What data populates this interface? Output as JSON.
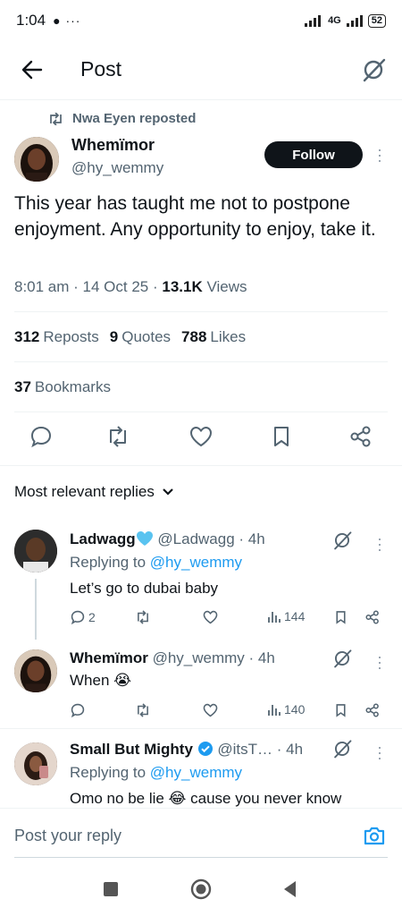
{
  "status_bar": {
    "time": "1:04",
    "extra": "● ···",
    "network": "4G",
    "battery": "52"
  },
  "header": {
    "title": "Post"
  },
  "repost": {
    "text": "Nwa Eyen reposted"
  },
  "tweet": {
    "author_name": "Whemïmor",
    "author_handle": "@hy_wemmy",
    "follow_label": "Follow",
    "text": "This year has taught me not to postpone enjoyment. Any opportunity to enjoy, take it.",
    "time": "8:01 am",
    "date": "14 Oct 25",
    "views_count": "13.1K",
    "views_label": "Views",
    "reposts_count": "312",
    "reposts_label": "Reposts",
    "quotes_count": "9",
    "quotes_label": "Quotes",
    "likes_count": "788",
    "likes_label": "Likes",
    "bookmarks_count": "37",
    "bookmarks_label": "Bookmarks"
  },
  "replies_header": {
    "label": "Most relevant replies"
  },
  "replies": [
    {
      "name": "Ladwagg",
      "handle": "@Ladwagg · 4h",
      "replying_to": "Replying to",
      "mention": "@hy_wemmy",
      "text": "Let’s go to dubai baby",
      "reply_count": "2",
      "views": "144"
    },
    {
      "name": "Whemïmor",
      "handle": "@hy_wemmy · 4h",
      "text": "When 😭",
      "views": "140"
    },
    {
      "name": "Small But Mighty",
      "handle": "@itsT… · 4h",
      "replying_to": "Replying to",
      "mention": "@hy_wemmy",
      "text": "Omo no be lie 😂 cause you never know"
    }
  ],
  "reply_bar": {
    "placeholder": "Post your reply"
  },
  "colors": {
    "accent": "#1d9bf0",
    "text": "#0f1419",
    "secondary": "#536471",
    "verified_heart": "#59c3f0"
  }
}
